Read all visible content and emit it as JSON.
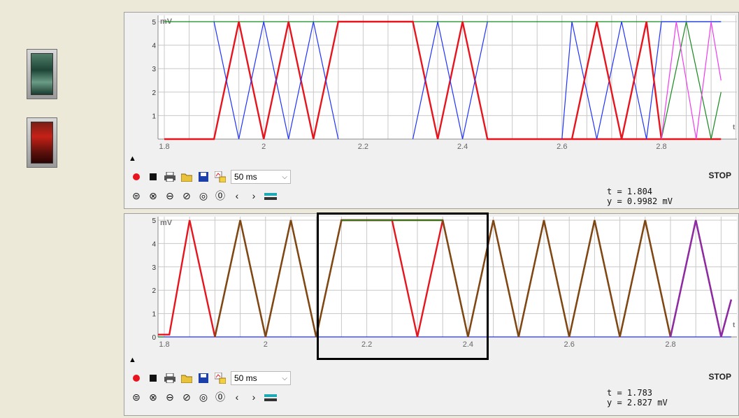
{
  "switches": [
    {
      "name": "green-switch",
      "color": "#1e4436"
    },
    {
      "name": "red-switch",
      "color": "#c62117"
    }
  ],
  "colors": {
    "red": "#e8141d",
    "blue": "#1f32ff",
    "green": "#16891e",
    "magenta": "#f03cf0",
    "brown": "#7a4a12",
    "purple": "#8a2caa",
    "grid": "#c8c8c8"
  },
  "scopes": [
    {
      "id": "top",
      "unit_label": "mV",
      "t_label": "t",
      "y_ticks": [
        "1",
        "2",
        "3",
        "4",
        "5"
      ],
      "x_ticks": [
        "1.8",
        "2",
        "2.2",
        "2.4",
        "2.6",
        "2.8"
      ],
      "toolbar": {
        "rate": "50 ms",
        "status": "STOP",
        "readout_t": "t = 1.804",
        "readout_y": "y = 0.9982 mV"
      },
      "series": [
        {
          "color": "blue",
          "points": [
            [
              1.8,
              0
            ],
            [
              1.9,
              0
            ]
          ]
        },
        {
          "color": "green",
          "points": [
            [
              1.8,
              5
            ],
            [
              2.92,
              5
            ]
          ]
        },
        {
          "color": "red",
          "points": [
            [
              1.8,
              0
            ],
            [
              1.9,
              0
            ],
            [
              1.95,
              5
            ],
            [
              2.0,
              0
            ],
            [
              2.05,
              5
            ],
            [
              2.1,
              0
            ],
            [
              2.15,
              5
            ],
            [
              2.3,
              5
            ],
            [
              2.35,
              0
            ],
            [
              2.4,
              5
            ],
            [
              2.45,
              0
            ],
            [
              2.92,
              0
            ]
          ]
        },
        {
          "color": "blue",
          "points": [
            [
              1.9,
              5
            ],
            [
              1.95,
              0
            ],
            [
              2.0,
              5
            ],
            [
              2.05,
              0
            ],
            [
              2.1,
              5
            ],
            [
              2.15,
              0
            ]
          ]
        },
        {
          "color": "blue",
          "points": [
            [
              2.3,
              0
            ],
            [
              2.35,
              5
            ],
            [
              2.4,
              0
            ],
            [
              2.45,
              5
            ]
          ]
        },
        {
          "color": "blue",
          "points": [
            [
              2.6,
              0
            ],
            [
              2.62,
              5
            ],
            [
              2.67,
              0
            ],
            [
              2.72,
              5
            ],
            [
              2.77,
              0
            ],
            [
              2.8,
              5
            ],
            [
              2.92,
              5
            ]
          ]
        },
        {
          "color": "red",
          "points": [
            [
              2.62,
              0
            ],
            [
              2.67,
              5
            ],
            [
              2.72,
              0
            ],
            [
              2.77,
              5
            ],
            [
              2.8,
              0
            ]
          ]
        },
        {
          "color": "green",
          "points": [
            [
              2.8,
              0
            ],
            [
              2.85,
              5
            ],
            [
              2.9,
              0
            ],
            [
              2.92,
              2
            ]
          ]
        },
        {
          "color": "magenta",
          "points": [
            [
              2.8,
              0
            ],
            [
              2.83,
              5
            ],
            [
              2.87,
              0
            ],
            [
              2.9,
              5
            ],
            [
              2.92,
              2.5
            ]
          ]
        }
      ]
    },
    {
      "id": "bottom",
      "unit_label": "mV",
      "t_label": "t",
      "y_ticks": [
        "0",
        "1",
        "2",
        "3",
        "4",
        "5"
      ],
      "x_ticks": [
        "1.8",
        "2",
        "2.2",
        "2.4",
        "2.6",
        "2.8"
      ],
      "toolbar": {
        "rate": "50 ms",
        "status": "STOP",
        "readout_t": "t = 1.783",
        "readout_y": "y = 2.827 mV"
      },
      "series": [
        {
          "color": "blue",
          "points": [
            [
              1.78,
              0
            ],
            [
              2.92,
              0
            ]
          ]
        },
        {
          "color": "green",
          "points": [
            [
              1.78,
              0
            ],
            [
              1.8,
              0
            ]
          ]
        },
        {
          "color": "red",
          "points": [
            [
              1.78,
              0.1
            ],
            [
              1.81,
              0.1
            ],
            [
              1.85,
              5
            ],
            [
              1.9,
              0
            ],
            [
              1.95,
              5
            ],
            [
              2.0,
              0
            ],
            [
              2.05,
              5
            ],
            [
              2.1,
              0
            ],
            [
              2.15,
              5
            ],
            [
              2.25,
              5
            ],
            [
              2.3,
              0
            ],
            [
              2.35,
              5
            ],
            [
              2.4,
              0
            ],
            [
              2.45,
              5
            ],
            [
              2.5,
              0
            ],
            [
              2.55,
              5
            ],
            [
              2.6,
              0
            ],
            [
              2.65,
              5
            ],
            [
              2.7,
              0
            ],
            [
              2.75,
              5
            ],
            [
              2.8,
              0
            ],
            [
              2.85,
              5
            ],
            [
              2.9,
              0
            ],
            [
              2.92,
              1.6
            ]
          ]
        },
        {
          "color": "brown",
          "points": [
            [
              1.9,
              0
            ],
            [
              1.95,
              5
            ],
            [
              2.0,
              0
            ],
            [
              2.05,
              5
            ],
            [
              2.1,
              0
            ],
            [
              2.15,
              5
            ],
            [
              2.35,
              5
            ],
            [
              2.4,
              0
            ],
            [
              2.45,
              5
            ],
            [
              2.5,
              0
            ],
            [
              2.55,
              5
            ],
            [
              2.6,
              0
            ],
            [
              2.65,
              5
            ],
            [
              2.7,
              0
            ],
            [
              2.75,
              5
            ],
            [
              2.8,
              0
            ]
          ]
        },
        {
          "color": "green",
          "points": [
            [
              2.15,
              5
            ],
            [
              2.35,
              5
            ]
          ]
        },
        {
          "color": "purple",
          "points": [
            [
              2.8,
              0
            ],
            [
              2.85,
              5
            ],
            [
              2.9,
              0
            ],
            [
              2.92,
              1.6
            ]
          ]
        }
      ]
    }
  ]
}
